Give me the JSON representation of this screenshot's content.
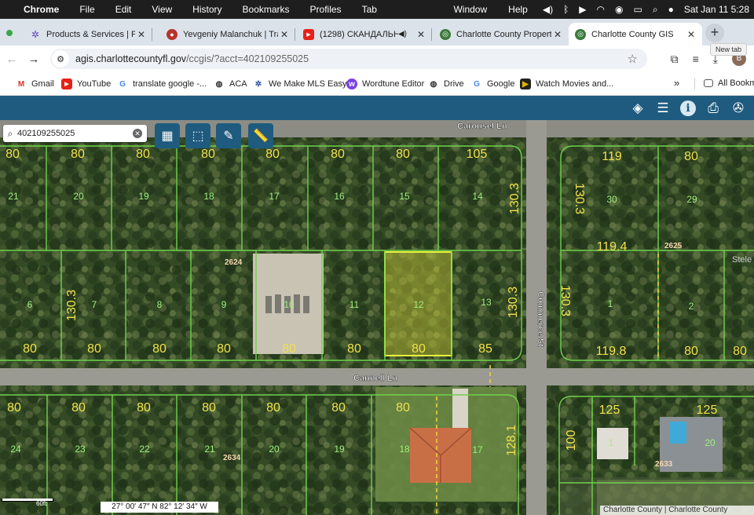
{
  "menubar": {
    "app": "Chrome",
    "items": [
      "File",
      "Edit",
      "View",
      "History",
      "Bookmarks",
      "Profiles",
      "Tab"
    ],
    "right_items": [
      "Window",
      "Help"
    ],
    "clock": "Sat Jan 11  5:28"
  },
  "tabs": [
    {
      "title": "Products & Services | Pun",
      "favicon": "gear-icon",
      "color": "#5a3fc4"
    },
    {
      "title": "Yevgeniy Malanchuk | Tra",
      "favicon": "profile-icon",
      "color": "#b5342c"
    },
    {
      "title": "(1298) СКАНДАЛЬНИ",
      "favicon": "youtube-icon",
      "color": "#e62117"
    },
    {
      "title": "Charlotte County Propert",
      "favicon": "county-seal-icon",
      "color": "#3b7a3b"
    },
    {
      "title": "Charlotte County GIS",
      "favicon": "county-seal-icon",
      "color": "#3b7a3b",
      "active": true
    }
  ],
  "new_tab_tooltip": "New tab",
  "address": {
    "host": "agis.charlottecountyfl.gov",
    "path": "/ccgis/?acct=402109255025"
  },
  "avatar_letter": "B",
  "bookmarks": [
    {
      "label": "Gmail",
      "icon": "gmail-icon",
      "color": "#d93025"
    },
    {
      "label": "YouTube",
      "icon": "youtube-icon",
      "color": "#e62117"
    },
    {
      "label": "translate google -...",
      "icon": "google-icon",
      "color": "#4285f4"
    },
    {
      "label": "ACA",
      "icon": "globe-icon",
      "color": "#333"
    },
    {
      "label": "We Make MLS Easy",
      "icon": "gear-icon",
      "color": "#2c4ea1"
    },
    {
      "label": "Wordtune Editor",
      "icon": "wordtune-icon",
      "color": "#7b3fe4"
    },
    {
      "label": "Drive",
      "icon": "globe-icon",
      "color": "#333"
    },
    {
      "label": "Google",
      "icon": "google-icon",
      "color": "#4285f4"
    },
    {
      "label": "Watch Movies and...",
      "icon": "movie-icon",
      "color": "#222"
    }
  ],
  "all_bookmarks": "All Bookm",
  "search": {
    "value": "402109255025"
  },
  "map": {
    "streets": [
      "Carousel Ln",
      "Cannell Ln",
      "Commerce St"
    ],
    "parcels_north_west": [
      {
        "dim": "80",
        "lot": "21"
      },
      {
        "dim": "80",
        "lot": "20"
      },
      {
        "dim": "80",
        "lot": "19"
      },
      {
        "dim": "80",
        "lot": "18"
      },
      {
        "dim": "80",
        "lot": "17"
      },
      {
        "dim": "80",
        "lot": "16"
      },
      {
        "dim": "80",
        "lot": "15"
      },
      {
        "dim": "105",
        "lot": "14"
      }
    ],
    "parcels_middle": [
      {
        "dim": "80",
        "lot": "6"
      },
      {
        "dim": "80",
        "lot": "7"
      },
      {
        "dim": "80",
        "lot": "8"
      },
      {
        "dim": "80",
        "lot": "9"
      },
      {
        "dim": "80",
        "lot": "10"
      },
      {
        "dim": "80",
        "lot": "11"
      },
      {
        "dim": "80",
        "lot": "12"
      },
      {
        "dim": "85",
        "lot": "13"
      }
    ],
    "parcels_south": [
      {
        "dim": "80",
        "lot": "24"
      },
      {
        "dim": "80",
        "lot": "23"
      },
      {
        "dim": "80",
        "lot": "22"
      },
      {
        "dim": "80",
        "lot": "21"
      },
      {
        "dim": "80",
        "lot": "20"
      },
      {
        "dim": "80",
        "lot": "19"
      },
      {
        "dim": "80",
        "lot": "18"
      },
      {
        "dim": "",
        "lot": "17"
      }
    ],
    "east_north": [
      {
        "dim": "119",
        "lot": "30"
      },
      {
        "dim": "80",
        "lot": "29"
      }
    ],
    "east_middle": [
      {
        "dim": "119.8",
        "lot": "1"
      },
      {
        "dim": "80",
        "lot": "2"
      }
    ],
    "east_south": [
      {
        "dim": "125",
        "lot": "1"
      },
      {
        "dim": "125",
        "lot": "20"
      }
    ],
    "side_dims": {
      "d130_3": "130.3",
      "d119_4": "119.4",
      "d128_1": "128.1",
      "d100": "100",
      "d80v": "80"
    },
    "block_numbers": [
      "2624",
      "2625",
      "2634",
      "2633"
    ],
    "selected_lot": "12",
    "scale_text": "60ft",
    "attribution": "Charlotte County | Charlotte County",
    "stele_text": "Stele"
  },
  "coords": "27° 00′ 47″ N 82° 12′ 34″ W"
}
